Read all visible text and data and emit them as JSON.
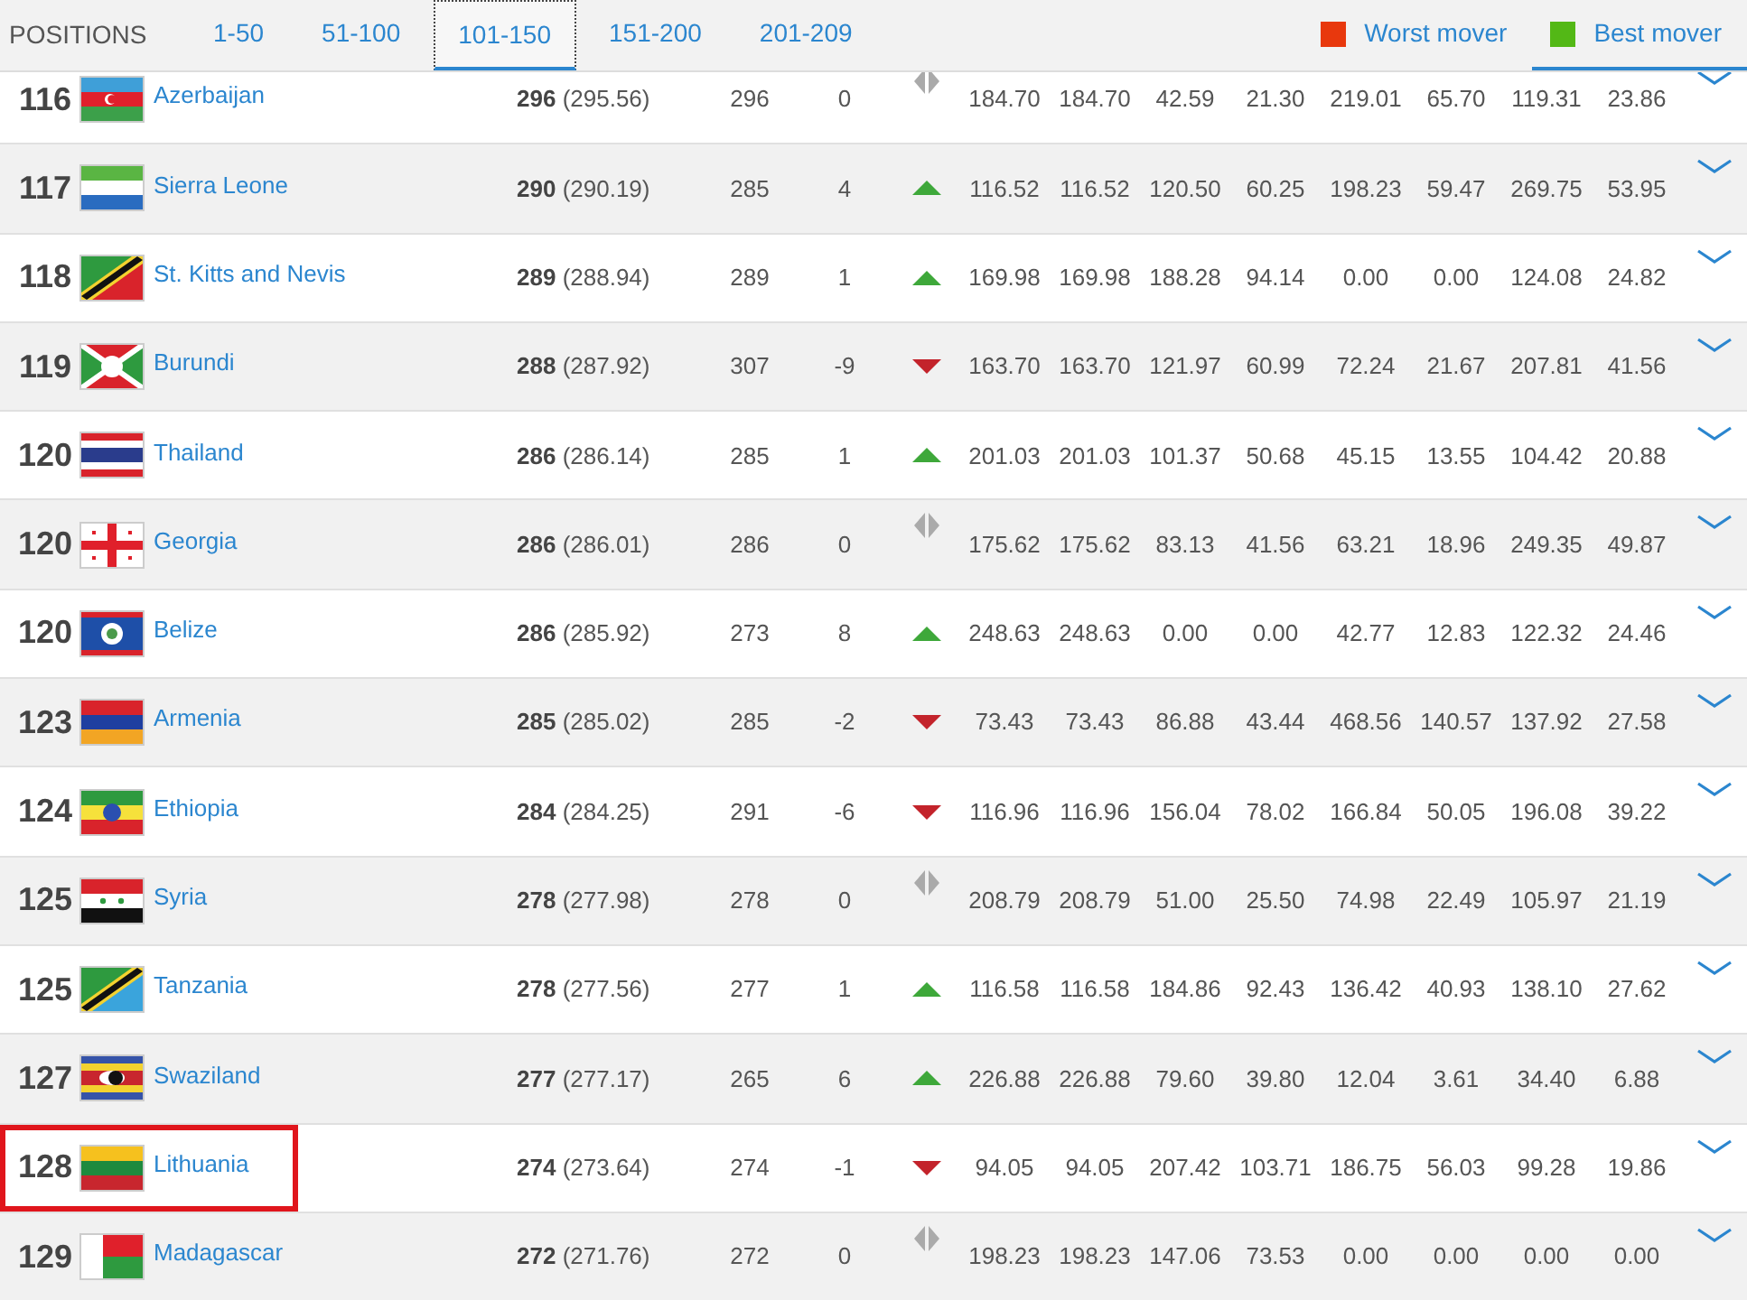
{
  "header": {
    "label": "POSITIONS",
    "tabs": [
      {
        "label": "1-50",
        "selected": false
      },
      {
        "label": "51-100",
        "selected": false
      },
      {
        "label": "101-150",
        "selected": true
      },
      {
        "label": "151-200",
        "selected": false
      },
      {
        "label": "201-209",
        "selected": false
      }
    ],
    "legend": [
      {
        "label": "Worst mover",
        "color": "#e8380d",
        "selected": false
      },
      {
        "label": "Best mover",
        "color": "#53b816",
        "selected": true
      }
    ]
  },
  "rows": [
    {
      "rank": "116",
      "name": "Azerbaijan",
      "points": "**296** (295.56)",
      "previous": "296",
      "change": "0",
      "kind": "same",
      "values": [
        "184.70",
        "184.70",
        "42.59",
        "21.30",
        "219.01",
        "65.70",
        "119.31",
        "23.86"
      ],
      "highlighted": false
    },
    {
      "rank": "117",
      "name": "Sierra Leone",
      "points": "**290** (290.19)",
      "previous": "285",
      "change": "4",
      "kind": "up",
      "values": [
        "116.52",
        "116.52",
        "120.50",
        "60.25",
        "198.23",
        "59.47",
        "269.75",
        "53.95"
      ],
      "highlighted": false
    },
    {
      "rank": "118",
      "name": "St. Kitts and Nevis",
      "points": "**289** (288.94)",
      "previous": "289",
      "change": "1",
      "kind": "up",
      "values": [
        "169.98",
        "169.98",
        "188.28",
        "94.14",
        "0.00",
        "0.00",
        "124.08",
        "24.82"
      ],
      "highlighted": false
    },
    {
      "rank": "119",
      "name": "Burundi",
      "points": "**288** (287.92)",
      "previous": "307",
      "change": "-9",
      "kind": "down",
      "values": [
        "163.70",
        "163.70",
        "121.97",
        "60.99",
        "72.24",
        "21.67",
        "207.81",
        "41.56"
      ],
      "highlighted": false
    },
    {
      "rank": "120",
      "name": "Thailand",
      "points": "**286** (286.14)",
      "previous": "285",
      "change": "1",
      "kind": "up",
      "values": [
        "201.03",
        "201.03",
        "101.37",
        "50.68",
        "45.15",
        "13.55",
        "104.42",
        "20.88"
      ],
      "highlighted": false
    },
    {
      "rank": "120",
      "name": "Georgia",
      "points": "**286** (286.01)",
      "previous": "286",
      "change": "0",
      "kind": "same",
      "values": [
        "175.62",
        "175.62",
        "83.13",
        "41.56",
        "63.21",
        "18.96",
        "249.35",
        "49.87"
      ],
      "highlighted": false
    },
    {
      "rank": "120",
      "name": "Belize",
      "points": "**286** (285.92)",
      "previous": "273",
      "change": "8",
      "kind": "up",
      "values": [
        "248.63",
        "248.63",
        "0.00",
        "0.00",
        "42.77",
        "12.83",
        "122.32",
        "24.46"
      ],
      "highlighted": false
    },
    {
      "rank": "123",
      "name": "Armenia",
      "points": "**285** (285.02)",
      "previous": "285",
      "change": "-2",
      "kind": "down",
      "values": [
        "73.43",
        "73.43",
        "86.88",
        "43.44",
        "468.56",
        "140.57",
        "137.92",
        "27.58"
      ],
      "highlighted": false
    },
    {
      "rank": "124",
      "name": "Ethiopia",
      "points": "**284** (284.25)",
      "previous": "291",
      "change": "-6",
      "kind": "down",
      "values": [
        "116.96",
        "116.96",
        "156.04",
        "78.02",
        "166.84",
        "50.05",
        "196.08",
        "39.22"
      ],
      "highlighted": false
    },
    {
      "rank": "125",
      "name": "Syria",
      "points": "**278** (277.98)",
      "previous": "278",
      "change": "0",
      "kind": "same",
      "values": [
        "208.79",
        "208.79",
        "51.00",
        "25.50",
        "74.98",
        "22.49",
        "105.97",
        "21.19"
      ],
      "highlighted": false
    },
    {
      "rank": "125",
      "name": "Tanzania",
      "points": "**278** (277.56)",
      "previous": "277",
      "change": "1",
      "kind": "up",
      "values": [
        "116.58",
        "116.58",
        "184.86",
        "92.43",
        "136.42",
        "40.93",
        "138.10",
        "27.62"
      ],
      "highlighted": false
    },
    {
      "rank": "127",
      "name": "Swaziland",
      "points": "**277** (277.17)",
      "previous": "265",
      "change": "6",
      "kind": "up",
      "values": [
        "226.88",
        "226.88",
        "79.60",
        "39.80",
        "12.04",
        "3.61",
        "34.40",
        "6.88"
      ],
      "highlighted": false
    },
    {
      "rank": "128",
      "name": "Lithuania",
      "points": "**274** (273.64)",
      "previous": "274",
      "change": "-1",
      "kind": "down",
      "values": [
        "94.05",
        "94.05",
        "207.42",
        "103.71",
        "186.75",
        "56.03",
        "99.28",
        "19.86"
      ],
      "highlighted": true
    },
    {
      "rank": "129",
      "name": "Madagascar",
      "points": "**272** (271.76)",
      "previous": "272",
      "change": "0",
      "kind": "same",
      "values": [
        "198.23",
        "198.23",
        "147.06",
        "73.53",
        "0.00",
        "0.00",
        "0.00",
        "0.00"
      ],
      "highlighted": false
    }
  ]
}
